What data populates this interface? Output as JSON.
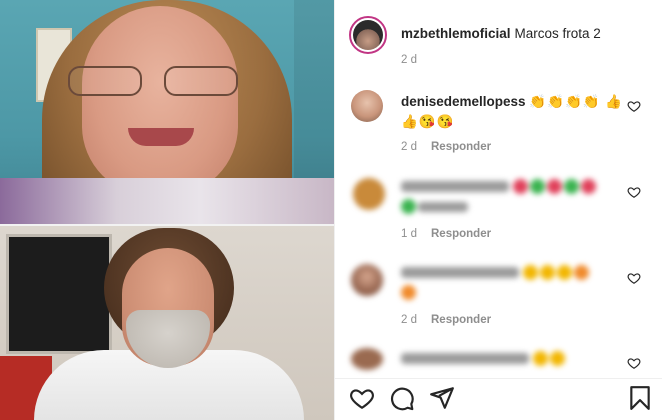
{
  "post": {
    "author": "mzbethlemoficial",
    "caption": "Marcos frota 2",
    "age": "2 d"
  },
  "comments": [
    {
      "username": "denisedemellopess",
      "text": "👏👏👏👏 👍👍😘😘",
      "age": "2 d",
      "reply_label": "Responder",
      "blurred": false
    },
    {
      "username": "",
      "text": "",
      "age": "1 d",
      "reply_label": "Responder",
      "blurred": true
    },
    {
      "username": "",
      "text": "",
      "age": "2 d",
      "reply_label": "Responder",
      "blurred": true
    },
    {
      "username": "",
      "text": "",
      "age": "",
      "reply_label": "",
      "blurred": true
    }
  ],
  "action_icons": [
    "heart-icon",
    "comment-icon",
    "share-icon",
    "bookmark-icon"
  ],
  "colors": {
    "story_ring": "#c13584",
    "text_primary": "#262626",
    "text_secondary": "#8e8e8e",
    "divider": "#efefef"
  }
}
